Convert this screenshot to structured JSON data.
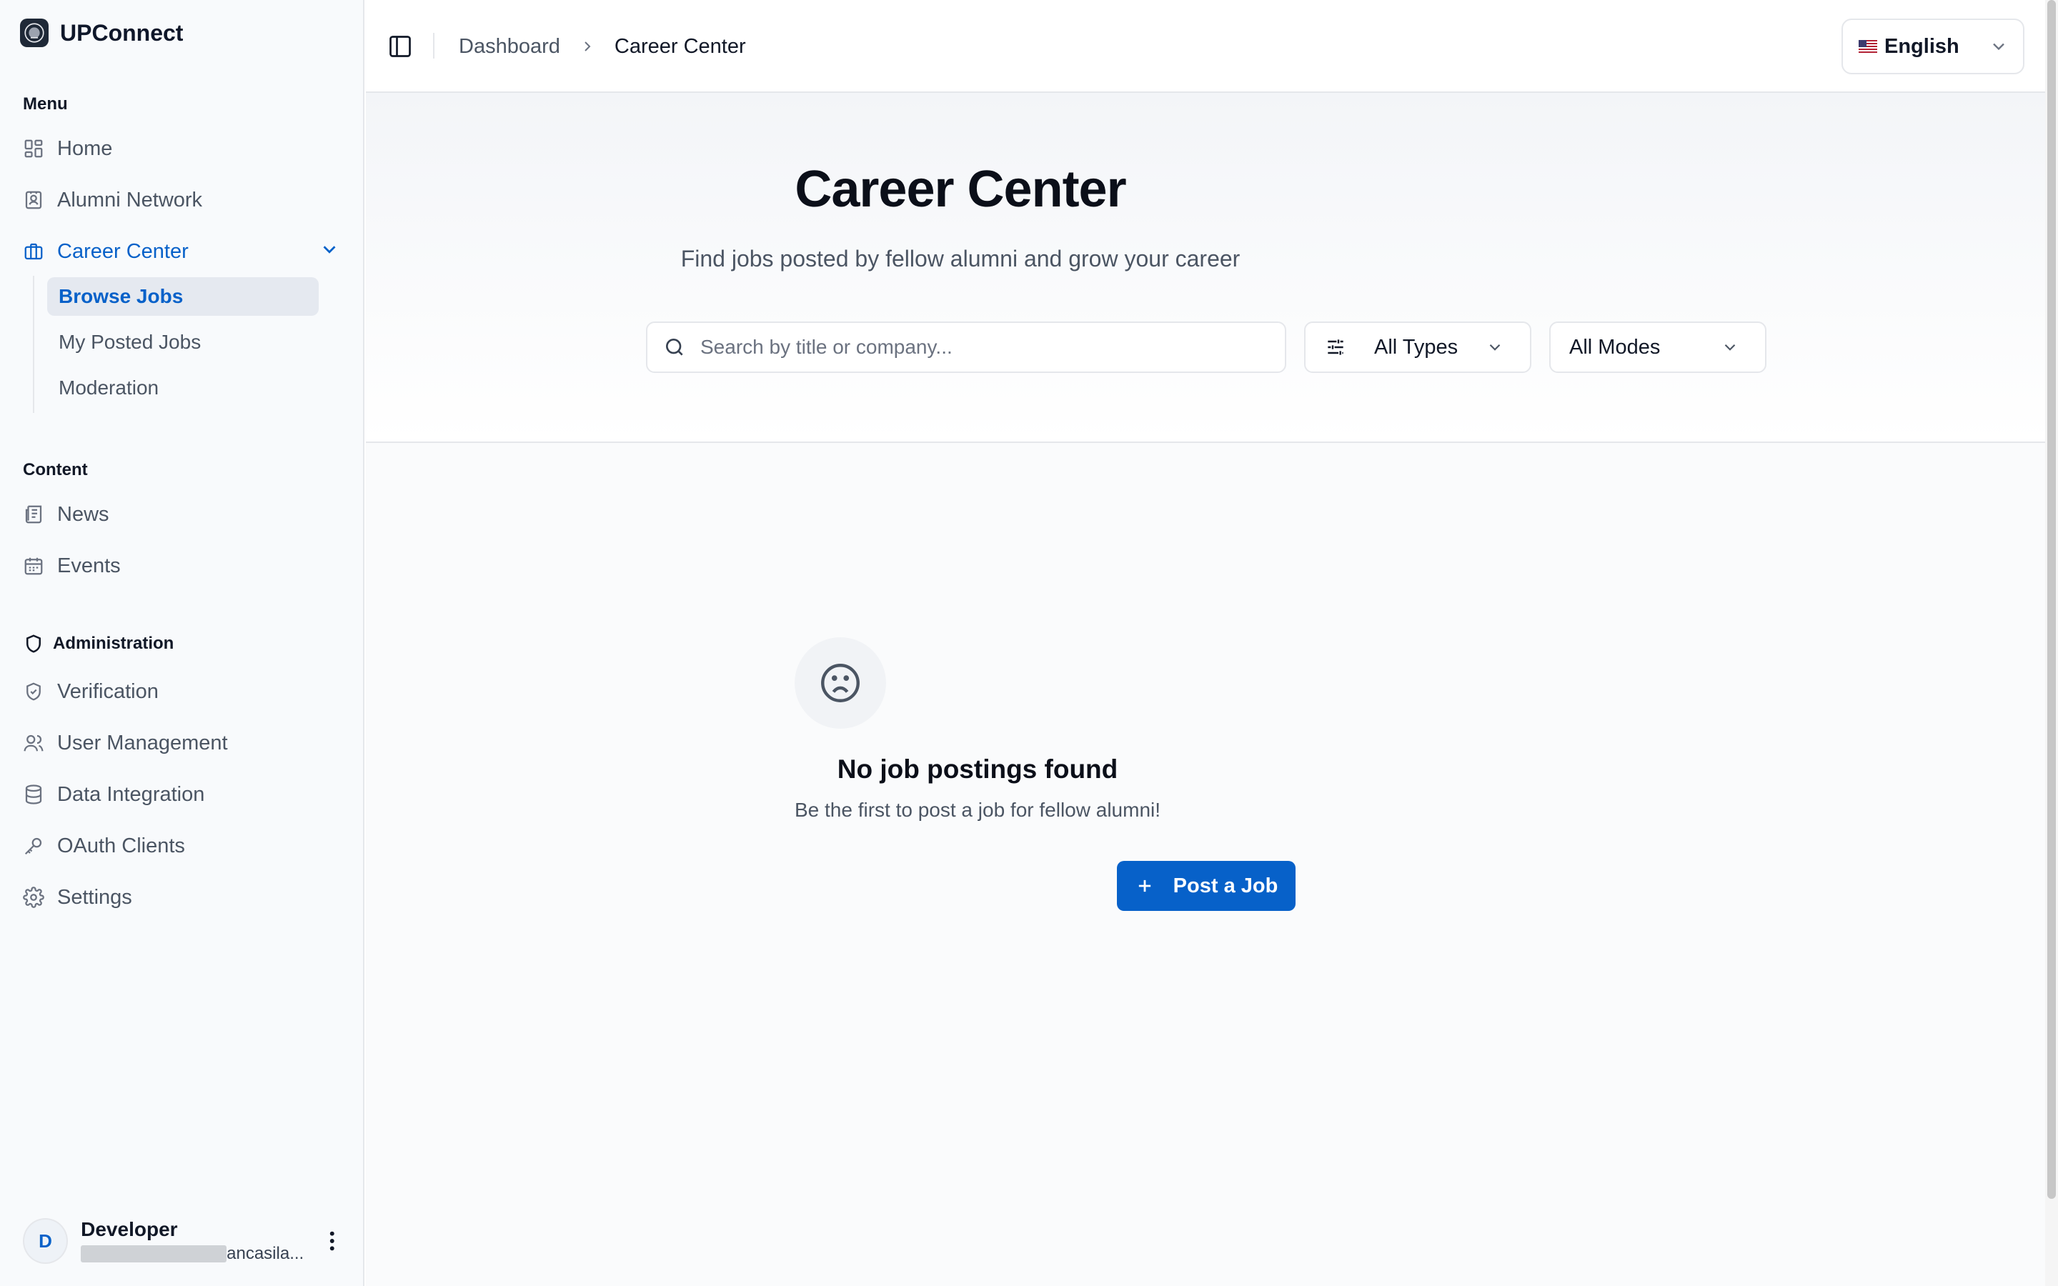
{
  "brand": {
    "name": "UPConnect",
    "logo_icon": "university-seal-icon"
  },
  "sidebar": {
    "menu_label": "Menu",
    "menu_items": [
      {
        "label": "Home",
        "icon": "grid-icon"
      },
      {
        "label": "Alumni Network",
        "icon": "contact-card-icon"
      },
      {
        "label": "Career Center",
        "icon": "briefcase-icon",
        "active": true
      }
    ],
    "career_sub_items": [
      {
        "label": "Browse Jobs",
        "active": true
      },
      {
        "label": "My Posted Jobs"
      },
      {
        "label": "Moderation"
      }
    ],
    "content_label": "Content",
    "content_items": [
      {
        "label": "News",
        "icon": "newspaper-icon"
      },
      {
        "label": "Events",
        "icon": "calendar-icon"
      }
    ],
    "admin_label": "Administration",
    "admin_items": [
      {
        "label": "Verification",
        "icon": "shield-check-icon"
      },
      {
        "label": "User Management",
        "icon": "users-icon"
      },
      {
        "label": "Data Integration",
        "icon": "database-icon"
      },
      {
        "label": "OAuth Clients",
        "icon": "key-icon"
      },
      {
        "label": "Settings",
        "icon": "gear-icon"
      }
    ],
    "user": {
      "initial": "D",
      "name": "Developer",
      "email_visible": "ancasila..."
    }
  },
  "header": {
    "breadcrumb": [
      "Dashboard",
      "Career Center"
    ],
    "language": "English"
  },
  "hero": {
    "title": "Career Center",
    "subtitle": "Find jobs posted by fellow alumni and grow your career",
    "search_placeholder": "Search by title or company...",
    "type_filter": "All Types",
    "mode_filter": "All Modes"
  },
  "empty_state": {
    "icon": "sad-face-icon",
    "title": "No job postings found",
    "description": "Be the first to post a job for fellow alumni!",
    "button_label": "Post a Job"
  },
  "colors": {
    "accent": "#0761c9",
    "sidebar_bg": "#f8fafc",
    "active_sub_bg": "#e5e9f0",
    "text_muted": "#4b5563"
  }
}
